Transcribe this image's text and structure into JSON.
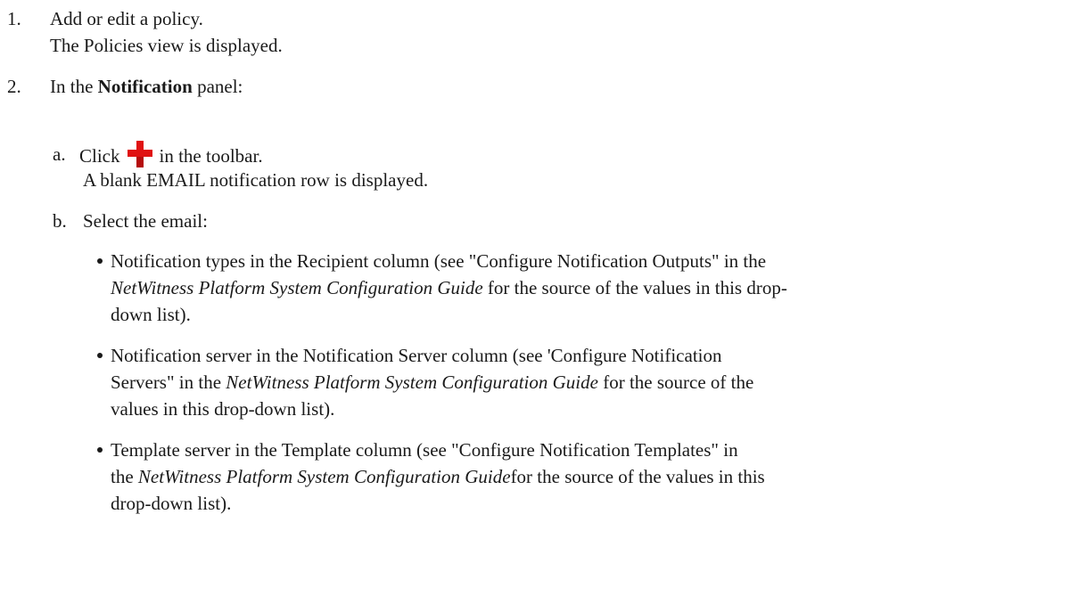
{
  "steps": [
    {
      "number": "1.",
      "text": "Add or edit a policy.",
      "result": "The Policies view is displayed."
    },
    {
      "number": "2.",
      "text_before": "In the ",
      "text_bold": "Notification",
      "text_after": " panel:"
    }
  ],
  "substeps": [
    {
      "letter": "a.",
      "text_before": "Click",
      "icon": "red-plus-icon",
      "text_after": "in the toolbar.",
      "result": "A blank EMAIL notification row is displayed."
    },
    {
      "letter": "b.",
      "text": "Select the email:"
    }
  ],
  "bullets": [
    {
      "line1": "Notification types in the Recipient column (see \"Configure Notification Outputs\" in the",
      "line2_italic": "NetWitness Platform System Configuration Guide",
      "line2_after": " for the source of the values in this drop-",
      "line3": "down list)."
    },
    {
      "line1": "Notification server in the Notification Server column (see 'Configure Notification",
      "line2_before": "Servers\" in the ",
      "line2_italic": "NetWitness Platform System Configuration Guide",
      "line2_after": " for the source of the",
      "line3": "values in this drop-down list)."
    },
    {
      "line1": "Template server in the Template column (see \"Configure Notification Templates\" in",
      "line2_before": "the ",
      "line2_italic": "NetWitness Platform System Configuration Guide",
      "line2_after": "for the source of the values in this",
      "line3": "drop-down list)."
    }
  ]
}
